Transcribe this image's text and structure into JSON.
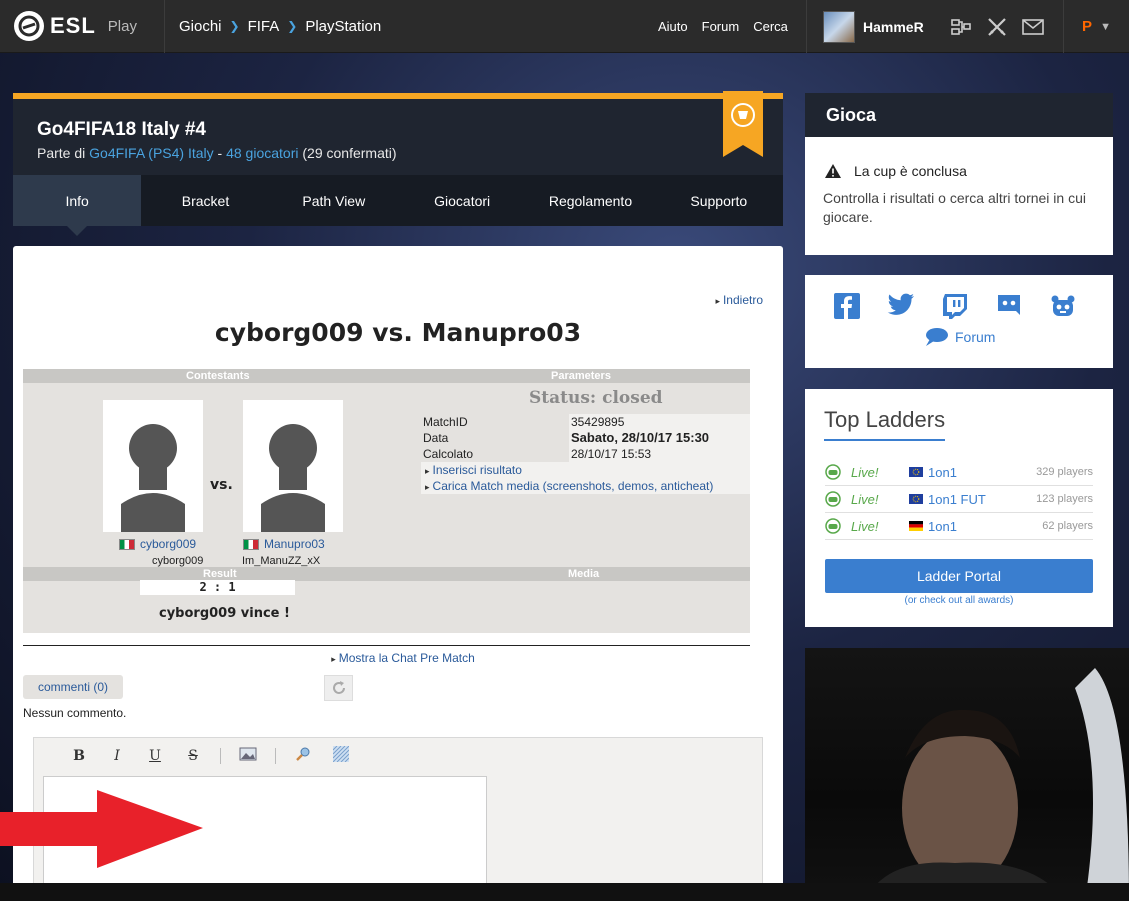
{
  "nav": {
    "logo": "ESL",
    "product": "Play",
    "breadcrumb": [
      "Giochi",
      "FIFA",
      "PlayStation"
    ],
    "links": [
      "Aiuto",
      "Forum",
      "Cerca"
    ],
    "username": "HammeR",
    "premium": "P"
  },
  "tournament": {
    "title": "Go4FIFA18 Italy #4",
    "part_of_prefix": "Parte di",
    "series_link": "Go4FIFA (PS4) Italy",
    "dash": "-",
    "players_link": "48 giocatori",
    "confirmed": "(29 confermati)"
  },
  "tabs": [
    "Info",
    "Bracket",
    "Path View",
    "Giocatori",
    "Regolamento",
    "Supporto"
  ],
  "match": {
    "back": "Indietro",
    "title": "cyborg009 vs. Manupro03",
    "contestants_label": "Contestants",
    "parameters_label": "Parameters",
    "status": "Status: closed",
    "vs": "vs.",
    "player1": {
      "name": "cyborg009",
      "nick": "cyborg009"
    },
    "player2": {
      "name": "Manupro03",
      "nick": "Im_ManuZZ_xX"
    },
    "params": [
      {
        "k": "MatchID",
        "v": "35429895"
      },
      {
        "k": "Data",
        "v": "Sabato, 28/10/17 15:30"
      },
      {
        "k": "Calcolato",
        "v": "28/10/17 15:53"
      }
    ],
    "link_result": "Inserisci risultato",
    "link_media": "Carica Match media (screenshots, demos, anticheat)",
    "result_label": "Result",
    "media_label": "Media",
    "score": "2 : 1",
    "winner": "cyborg009 vince !",
    "chat_link": "Mostra la Chat Pre Match",
    "comments_tab": "commenti (0)",
    "no_comments": "Nessun commento.",
    "editor_buttons": [
      "B",
      "I",
      "U",
      "S"
    ]
  },
  "sidebar": {
    "play_title": "Gioca",
    "cup_status": "La cup è conclusa",
    "cup_text": "Controlla i risultati o cerca altri tornei in cui giocare.",
    "forum": "Forum",
    "ladders_title": "Top Ladders",
    "ladders": [
      {
        "live": "Live!",
        "name": "1on1",
        "count": "329 players",
        "flag": "eu"
      },
      {
        "live": "Live!",
        "name": "1on1 FUT",
        "count": "123 players",
        "flag": "eu"
      },
      {
        "live": "Live!",
        "name": "1on1",
        "count": "62 players",
        "flag": "de"
      }
    ],
    "ladder_portal": "Ladder Portal",
    "awards": "(or check out all awards)"
  },
  "colors": {
    "accent": "#3a7ecf",
    "orange": "#f6a623",
    "dark": "#1f2530",
    "live": "#58a84a"
  }
}
